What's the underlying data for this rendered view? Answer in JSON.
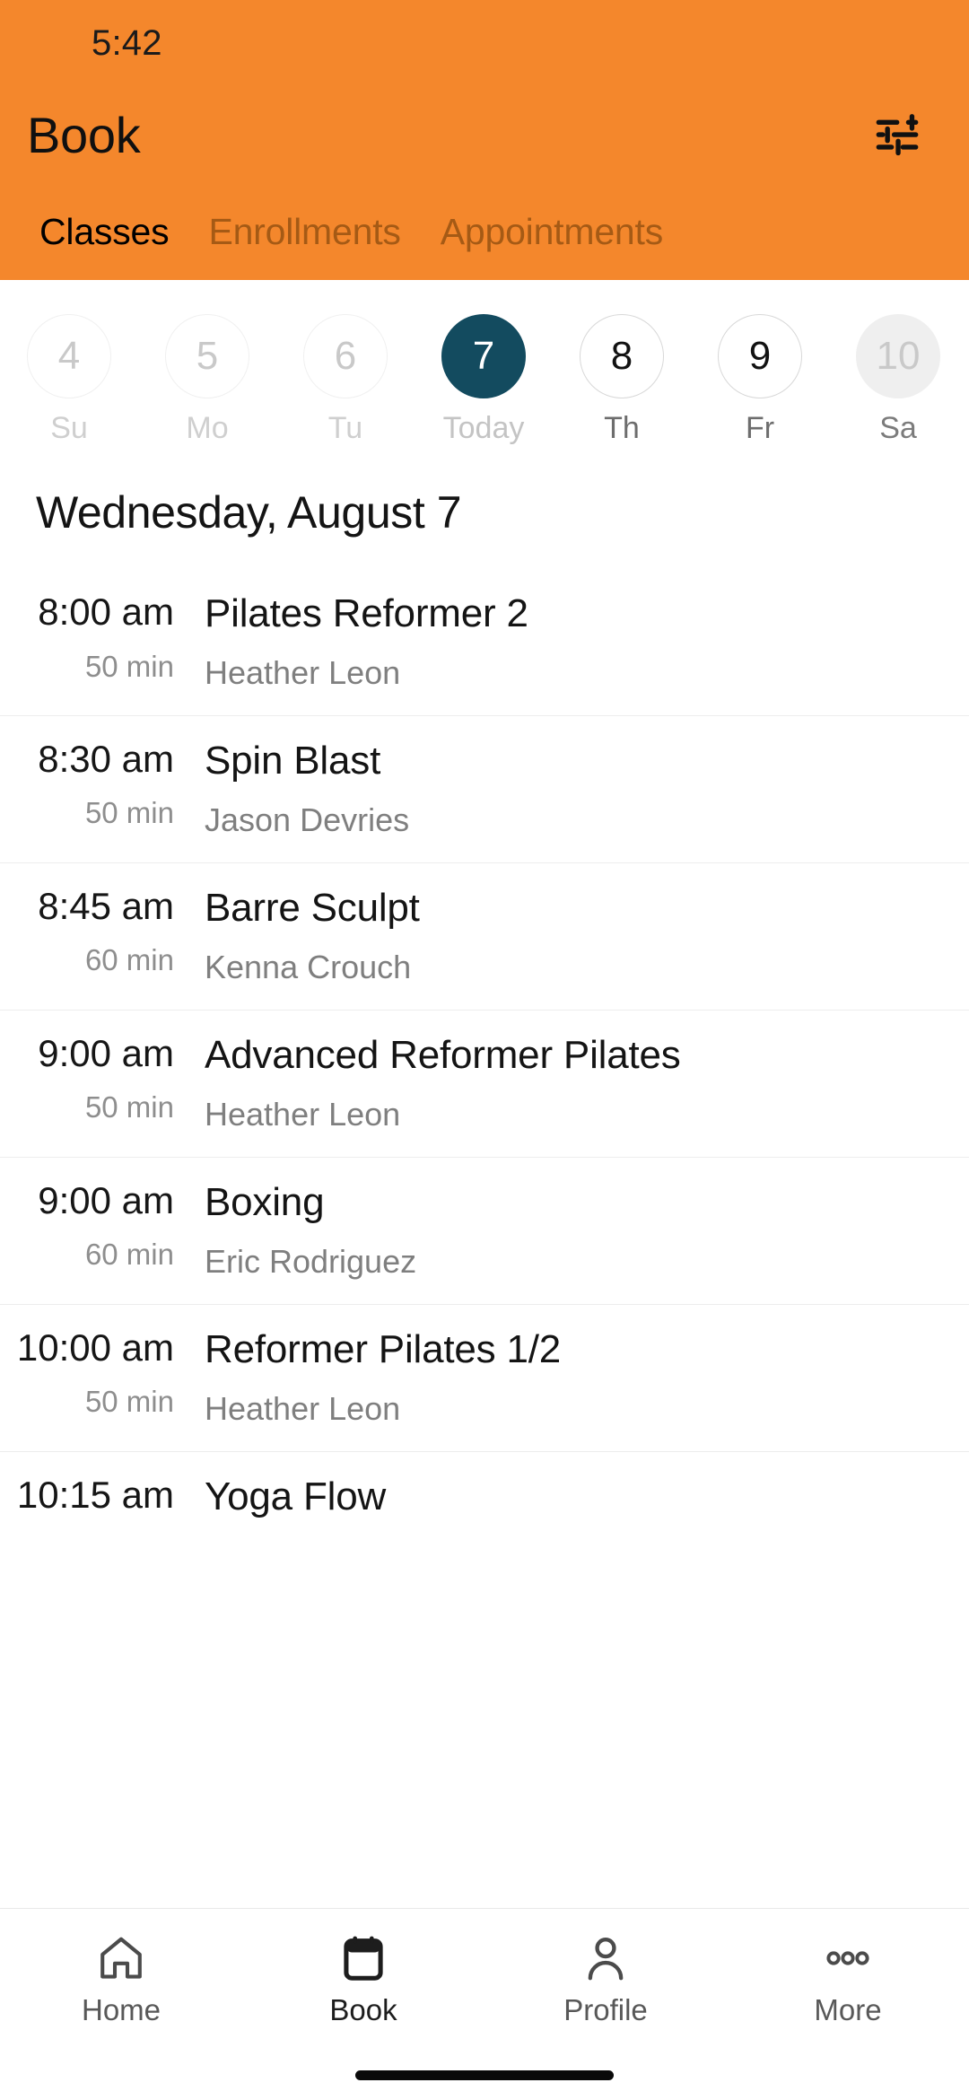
{
  "statusbar": {
    "time": "5:42"
  },
  "header": {
    "title": "Book",
    "accent_color": "#f4872c",
    "filter_icon": "tune-icon",
    "tabs": [
      {
        "label": "Classes",
        "active": true
      },
      {
        "label": "Enrollments",
        "active": false
      },
      {
        "label": "Appointments",
        "active": false
      }
    ]
  },
  "datestrip": {
    "selected_color": "#134b5f",
    "days": [
      {
        "number": "4",
        "label": "Su",
        "state": "past"
      },
      {
        "number": "5",
        "label": "Mo",
        "state": "past"
      },
      {
        "number": "6",
        "label": "Tu",
        "state": "past"
      },
      {
        "number": "7",
        "label": "Today",
        "state": "today"
      },
      {
        "number": "8",
        "label": "Th",
        "state": "available"
      },
      {
        "number": "9",
        "label": "Fr",
        "state": "available"
      },
      {
        "number": "10",
        "label": "Sa",
        "state": "unavailable"
      }
    ]
  },
  "day_heading": "Wednesday, August 7",
  "classes": [
    {
      "time": "8:00 am",
      "duration": "50 min",
      "name": "Pilates Reformer 2",
      "instructor": "Heather Leon"
    },
    {
      "time": "8:30 am",
      "duration": "50 min",
      "name": "Spin Blast",
      "instructor": "Jason Devries"
    },
    {
      "time": "8:45 am",
      "duration": "60 min",
      "name": "Barre Sculpt",
      "instructor": "Kenna Crouch"
    },
    {
      "time": "9:00 am",
      "duration": "50 min",
      "name": "Advanced Reformer Pilates",
      "instructor": "Heather Leon"
    },
    {
      "time": "9:00 am",
      "duration": "60 min",
      "name": "Boxing",
      "instructor": "Eric Rodriguez"
    },
    {
      "time": "10:00 am",
      "duration": "50 min",
      "name": "Reformer Pilates 1/2",
      "instructor": "Heather Leon"
    },
    {
      "time": "10:15 am",
      "duration": "",
      "name": "Yoga Flow",
      "instructor": ""
    }
  ],
  "bottomnav": {
    "items": [
      {
        "label": "Home",
        "icon": "home-icon",
        "active": false
      },
      {
        "label": "Book",
        "icon": "calendar-icon",
        "active": true
      },
      {
        "label": "Profile",
        "icon": "person-icon",
        "active": false
      },
      {
        "label": "More",
        "icon": "ellipsis-icon",
        "active": false
      }
    ]
  }
}
